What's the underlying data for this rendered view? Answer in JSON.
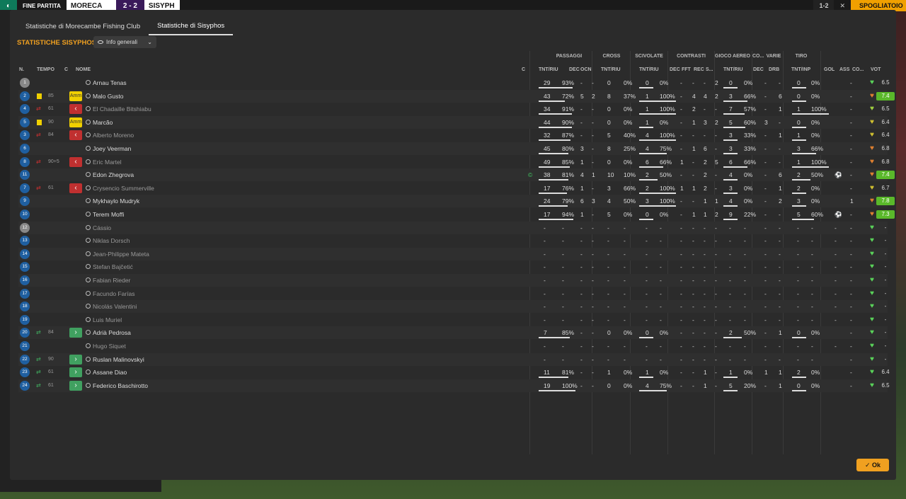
{
  "topbar": {
    "end": "FINE PARTITA",
    "home": "MORECA",
    "score": "2 - 2",
    "away": "SISYPH",
    "t2": "1-2",
    "close": "✕",
    "cont": "SPOGLIATOIO"
  },
  "tabs": [
    "Statistiche di Morecambe Fishing Club",
    "Statistiche di Sisyphos"
  ],
  "title": "STATISTICHE SISYPHOS",
  "dropdown": "Info generali",
  "groups": [
    "PASSAGGI",
    "CROSS",
    "SCIVOLATE",
    "CONTRASTI",
    "GIOCO AEREO",
    "CO...",
    "VARIE",
    "TIRO"
  ],
  "headers": {
    "n": "N.",
    "tempo": "TEMPO",
    "c": "C",
    "nome": "NOME",
    "c2": "C",
    "p": "TNT/RIU",
    "dec": "DEC",
    "ocn": "OCN",
    "cr": "TNT/RIU",
    "sc": "TNT/RIU",
    "cdec": "DEC",
    "fft": "FFT",
    "rec": "REC",
    "s": "S...",
    "ga": "TNT/RIU",
    "codec": "DEC",
    "drb": "DRB",
    "tiro": "TNT/INP",
    "gol": "GOL",
    "ass": "ASS",
    "co": "CO...",
    "vot": "VOT"
  },
  "players": [
    {
      "n": "1",
      "gk": true,
      "t": "",
      "name": "Arnau Tenas",
      "p1": "29",
      "p2": "93%",
      "dec": "-",
      "ocn": "-",
      "c1": "0",
      "c2": "0%",
      "s1": "0",
      "s2": "0%",
      "cd": "-",
      "ff": "-",
      "re": "-",
      "ss": "2",
      "g1": "0",
      "g2": "0%",
      "co": "-",
      "dr": "-",
      "t1": "0",
      "t2": "0%",
      "gol": "",
      "ass": "-",
      "rate": "6.5",
      "hl": false,
      "hc": "#5ad35a"
    },
    {
      "n": "2",
      "t": "85",
      "card": "Amm",
      "name": "Malo Gusto",
      "p1": "43",
      "p2": "72%",
      "dec": "5",
      "ocn": "2",
      "c1": "8",
      "c2": "37%",
      "s1": "1",
      "s2": "100%",
      "cd": "-",
      "ff": "4",
      "re": "4",
      "ss": "2",
      "g1": "3",
      "g2": "66%",
      "co": "-",
      "dr": "6",
      "t1": "0",
      "t2": "0%",
      "gol": "",
      "ass": "-",
      "rate": "7.4",
      "hl": true,
      "hc": "#e08030"
    },
    {
      "n": "4",
      "t": "61",
      "out": true,
      "sub": true,
      "name": "El Chadaille Bitshiabu",
      "p1": "34",
      "p2": "91%",
      "dec": "-",
      "ocn": "-",
      "c1": "0",
      "c2": "0%",
      "s1": "1",
      "s2": "100%",
      "cd": "-",
      "ff": "2",
      "re": "-",
      "ss": "-",
      "g1": "7",
      "g2": "57%",
      "co": "-",
      "dr": "1",
      "t1": "1",
      "t2": "100%",
      "gol": "",
      "ass": "-",
      "rate": "6.5",
      "hl": false,
      "hc": "#a0d040"
    },
    {
      "n": "5",
      "t": "90",
      "card": "Amm",
      "name": "Marcão",
      "p1": "44",
      "p2": "90%",
      "dec": "-",
      "ocn": "-",
      "c1": "0",
      "c2": "0%",
      "s1": "1",
      "s2": "0%",
      "cd": "-",
      "ff": "1",
      "re": "3",
      "ss": "2",
      "g1": "5",
      "g2": "60%",
      "co": "3",
      "dr": "-",
      "t1": "0",
      "t2": "0%",
      "gol": "",
      "ass": "-",
      "rate": "6.4",
      "hl": false,
      "hc": "#d0c030"
    },
    {
      "n": "3",
      "t": "84",
      "out": true,
      "sub": true,
      "name": "Alberto Moreno",
      "p1": "32",
      "p2": "87%",
      "dec": "-",
      "ocn": "-",
      "c1": "5",
      "c2": "40%",
      "s1": "4",
      "s2": "100%",
      "cd": "-",
      "ff": "-",
      "re": "-",
      "ss": "-",
      "g1": "3",
      "g2": "33%",
      "co": "-",
      "dr": "1",
      "t1": "1",
      "t2": "0%",
      "gol": "",
      "ass": "-",
      "rate": "6.4",
      "hl": false,
      "hc": "#d0c030"
    },
    {
      "n": "6",
      "t": "",
      "name": "Joey Veerman",
      "p1": "45",
      "p2": "80%",
      "dec": "3",
      "ocn": "-",
      "c1": "8",
      "c2": "25%",
      "s1": "4",
      "s2": "75%",
      "cd": "-",
      "ff": "1",
      "re": "6",
      "ss": "-",
      "g1": "3",
      "g2": "33%",
      "co": "-",
      "dr": "-",
      "t1": "3",
      "t2": "66%",
      "gol": "",
      "ass": "-",
      "rate": "6.8",
      "hl": false,
      "hc": "#e08030"
    },
    {
      "n": "8",
      "t": "90+5",
      "out": true,
      "sub": true,
      "name": "Eric Martel",
      "p1": "49",
      "p2": "85%",
      "dec": "1",
      "ocn": "-",
      "c1": "0",
      "c2": "0%",
      "s1": "6",
      "s2": "66%",
      "cd": "1",
      "ff": "-",
      "re": "2",
      "ss": "5",
      "g1": "6",
      "g2": "66%",
      "co": "-",
      "dr": "-",
      "t1": "1",
      "t2": "100%",
      "gol": "",
      "ass": "-",
      "rate": "6.8",
      "hl": false,
      "hc": "#e08030"
    },
    {
      "n": "11",
      "t": "",
      "cap": true,
      "name": "Edon Zhegrova",
      "p1": "38",
      "p2": "81%",
      "dec": "4",
      "ocn": "1",
      "c1": "10",
      "c2": "10%",
      "s1": "2",
      "s2": "50%",
      "cd": "-",
      "ff": "-",
      "re": "2",
      "ss": "-",
      "g1": "4",
      "g2": "0%",
      "co": "-",
      "dr": "6",
      "t1": "2",
      "t2": "50%",
      "gol": "⚽",
      "ass": "-",
      "rate": "7.4",
      "hl": true,
      "hc": "#e08030"
    },
    {
      "n": "7",
      "t": "61",
      "out": true,
      "sub": true,
      "name": "Crysencio Summerville",
      "p1": "17",
      "p2": "76%",
      "dec": "1",
      "ocn": "-",
      "c1": "3",
      "c2": "66%",
      "s1": "2",
      "s2": "100%",
      "cd": "1",
      "ff": "1",
      "re": "2",
      "ss": "-",
      "g1": "3",
      "g2": "0%",
      "co": "-",
      "dr": "1",
      "t1": "2",
      "t2": "0%",
      "gol": "",
      "ass": "-",
      "rate": "6.7",
      "hl": false,
      "hc": "#d0c030"
    },
    {
      "n": "9",
      "t": "",
      "name": "Mykhaylo Mudryk",
      "p1": "24",
      "p2": "79%",
      "dec": "6",
      "ocn": "3",
      "c1": "4",
      "c2": "50%",
      "s1": "3",
      "s2": "100%",
      "cd": "-",
      "ff": "-",
      "re": "1",
      "ss": "1",
      "g1": "4",
      "g2": "0%",
      "co": "-",
      "dr": "2",
      "t1": "3",
      "t2": "0%",
      "gol": "",
      "ass": "1",
      "rate": "7.8",
      "hl": true,
      "hc": "#e08030"
    },
    {
      "n": "10",
      "t": "",
      "name": "Terem Moffi",
      "p1": "17",
      "p2": "94%",
      "dec": "1",
      "ocn": "-",
      "c1": "5",
      "c2": "0%",
      "s1": "0",
      "s2": "0%",
      "cd": "-",
      "ff": "1",
      "re": "1",
      "ss": "2",
      "g1": "9",
      "g2": "22%",
      "co": "-",
      "dr": "-",
      "t1": "5",
      "t2": "60%",
      "gol": "⚽",
      "ass": "-",
      "rate": "7.3",
      "hl": true,
      "hc": "#e08030"
    },
    {
      "n": "12",
      "gk": true,
      "t": "",
      "name": "Cássio",
      "empty": true
    },
    {
      "n": "13",
      "t": "",
      "name": "Niklas Dorsch",
      "empty": true
    },
    {
      "n": "14",
      "t": "",
      "name": "Jean-Philippe Mateta",
      "empty": true
    },
    {
      "n": "15",
      "t": "",
      "name": "Stefan Bajčetić",
      "empty": true
    },
    {
      "n": "16",
      "t": "",
      "name": "Fabian Rieder",
      "empty": true
    },
    {
      "n": "17",
      "t": "",
      "name": "Facundo Farías",
      "empty": true
    },
    {
      "n": "18",
      "t": "",
      "name": "Nicolás Valentini",
      "empty": true
    },
    {
      "n": "19",
      "t": "",
      "name": "Luis Muriel",
      "empty": true
    },
    {
      "n": "20",
      "t": "84",
      "in": true,
      "name": "Adrià Pedrosa",
      "p1": "7",
      "p2": "85%",
      "dec": "-",
      "ocn": "-",
      "c1": "0",
      "c2": "0%",
      "s1": "0",
      "s2": "0%",
      "cd": "-",
      "ff": "-",
      "re": "-",
      "ss": "-",
      "g1": "2",
      "g2": "50%",
      "co": "-",
      "dr": "1",
      "t1": "0",
      "t2": "0%",
      "gol": "",
      "ass": "-",
      "rate": "-",
      "hl": false,
      "hc": "#5ad35a"
    },
    {
      "n": "21",
      "t": "",
      "name": "Hugo Siquet",
      "empty": true
    },
    {
      "n": "22",
      "t": "90",
      "in": true,
      "name": "Ruslan Malinovskyi",
      "p1": "-",
      "p2": "-",
      "dec": "-",
      "ocn": "-",
      "c1": "-",
      "c2": "-",
      "s1": "-",
      "s2": "-",
      "cd": "-",
      "ff": "-",
      "re": "-",
      "ss": "-",
      "g1": "-",
      "g2": "-",
      "co": "-",
      "dr": "-",
      "t1": "-",
      "t2": "-",
      "gol": "",
      "ass": "-",
      "rate": "-",
      "hl": false,
      "hc": "#5ad35a",
      "nobar": true
    },
    {
      "n": "23",
      "t": "61",
      "in": true,
      "name": "Assane Diao",
      "p1": "11",
      "p2": "81%",
      "dec": "-",
      "ocn": "-",
      "c1": "1",
      "c2": "0%",
      "s1": "1",
      "s2": "0%",
      "cd": "-",
      "ff": "-",
      "re": "1",
      "ss": "-",
      "g1": "1",
      "g2": "0%",
      "co": "1",
      "dr": "1",
      "t1": "2",
      "t2": "0%",
      "gol": "",
      "ass": "-",
      "rate": "6.4",
      "hl": false,
      "hc": "#5ad35a"
    },
    {
      "n": "24",
      "t": "61",
      "in": true,
      "name": "Federico Baschirotto",
      "p1": "19",
      "p2": "100%",
      "dec": "-",
      "ocn": "-",
      "c1": "0",
      "c2": "0%",
      "s1": "4",
      "s2": "75%",
      "cd": "-",
      "ff": "-",
      "re": "1",
      "ss": "-",
      "g1": "5",
      "g2": "20%",
      "co": "-",
      "dr": "1",
      "t1": "0",
      "t2": "0%",
      "gol": "",
      "ass": "-",
      "rate": "6.5",
      "hl": false,
      "hc": "#5ad35a"
    }
  ],
  "ok": "Ok"
}
